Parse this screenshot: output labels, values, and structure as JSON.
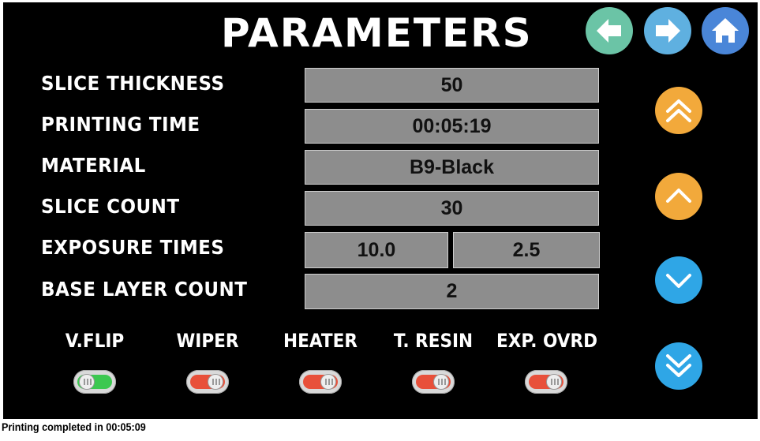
{
  "title": "PARAMETERS",
  "nav": {
    "back_icon": "arrow-left-icon",
    "forward_icon": "arrow-right-icon",
    "home_icon": "home-icon",
    "back_color": "#6bc4a6",
    "forward_color": "#5fb0e0",
    "home_color": "#4a86d8"
  },
  "params": [
    {
      "label": "SLICE THICKNESS",
      "value": "50"
    },
    {
      "label": "PRINTING TIME",
      "value": "00:05:19"
    },
    {
      "label": "MATERIAL",
      "value": "B9-Black"
    },
    {
      "label": "SLICE COUNT",
      "value": "30"
    },
    {
      "label": "EXPOSURE TIMES",
      "value": "10.0",
      "value2": "2.5"
    },
    {
      "label": "BASE LAYER COUNT",
      "value": "2"
    }
  ],
  "scroll": {
    "page_up_icon": "double-chevron-up-icon",
    "up_icon": "chevron-up-icon",
    "down_icon": "chevron-down-icon",
    "page_down_icon": "double-chevron-down-icon",
    "up_color": "#f2a93b",
    "down_color": "#2fa6e6"
  },
  "toggles": [
    {
      "label": "V.FLIP",
      "on": true
    },
    {
      "label": "WIPER",
      "on": false
    },
    {
      "label": "HEATER",
      "on": false
    },
    {
      "label": "T. RESIN",
      "on": false
    },
    {
      "label": "EXP. OVRD",
      "on": false
    }
  ],
  "status": "Printing completed in 00:05:09"
}
